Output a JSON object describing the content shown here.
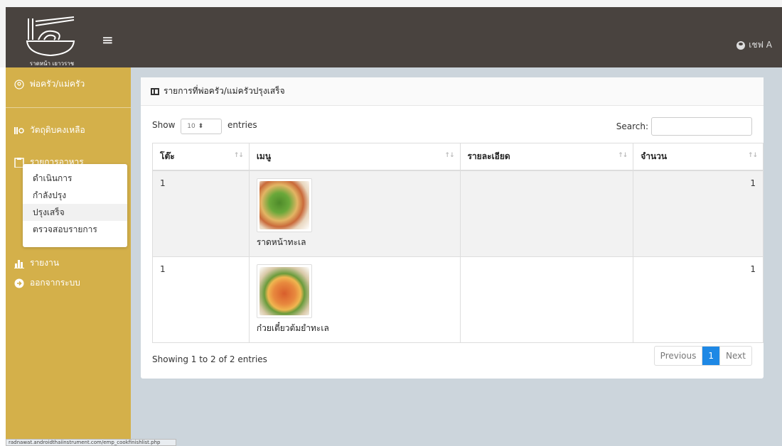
{
  "header": {
    "user_label": "เชฟ A",
    "accent_dark": "#49433f",
    "sidebar_color": "#d4b04a",
    "logo_text": "ราดหน้า เยาวราช"
  },
  "sidebar": {
    "role_label": "พ่อครัว/แม่ครัว",
    "items": [
      {
        "label": "วัตถุดิบคงเหลือ"
      },
      {
        "label": "รายการอาหาร"
      },
      {
        "label": "รายงาน"
      },
      {
        "label": "ออกจากระบบ"
      }
    ],
    "submenu": [
      {
        "label": "ดำเนินการ"
      },
      {
        "label": "กำลังปรุง"
      },
      {
        "label": "ปรุงเสร็จ"
      },
      {
        "label": "ตรวจสอบรายการ"
      }
    ]
  },
  "card": {
    "title": "รายการที่พ่อครัว/แม่ครัวปรุงเสร็จ"
  },
  "controls": {
    "show_label": "Show",
    "show_value": "10",
    "entries_label": "entries",
    "search_label": "Search:"
  },
  "table": {
    "headers": [
      "โต๊ะ",
      "เมนู",
      "รายละเอียด",
      "จำนวน"
    ],
    "rows": [
      {
        "table": "1",
        "menu": "ราดหน้าทะเล",
        "detail": "",
        "qty": "1"
      },
      {
        "table": "1",
        "menu": "ก๋วยเตี๋ยวต้มยำทะเล",
        "detail": "",
        "qty": "1"
      }
    ]
  },
  "footer": {
    "info": "Showing 1 to 2 of 2 entries",
    "prev": "Previous",
    "page": "1",
    "next": "Next",
    "active_color": "#1e88e5"
  },
  "statusbar": {
    "url": "radnawat.androidthaiinstrument.com/emp_cookfinishlist.php"
  }
}
